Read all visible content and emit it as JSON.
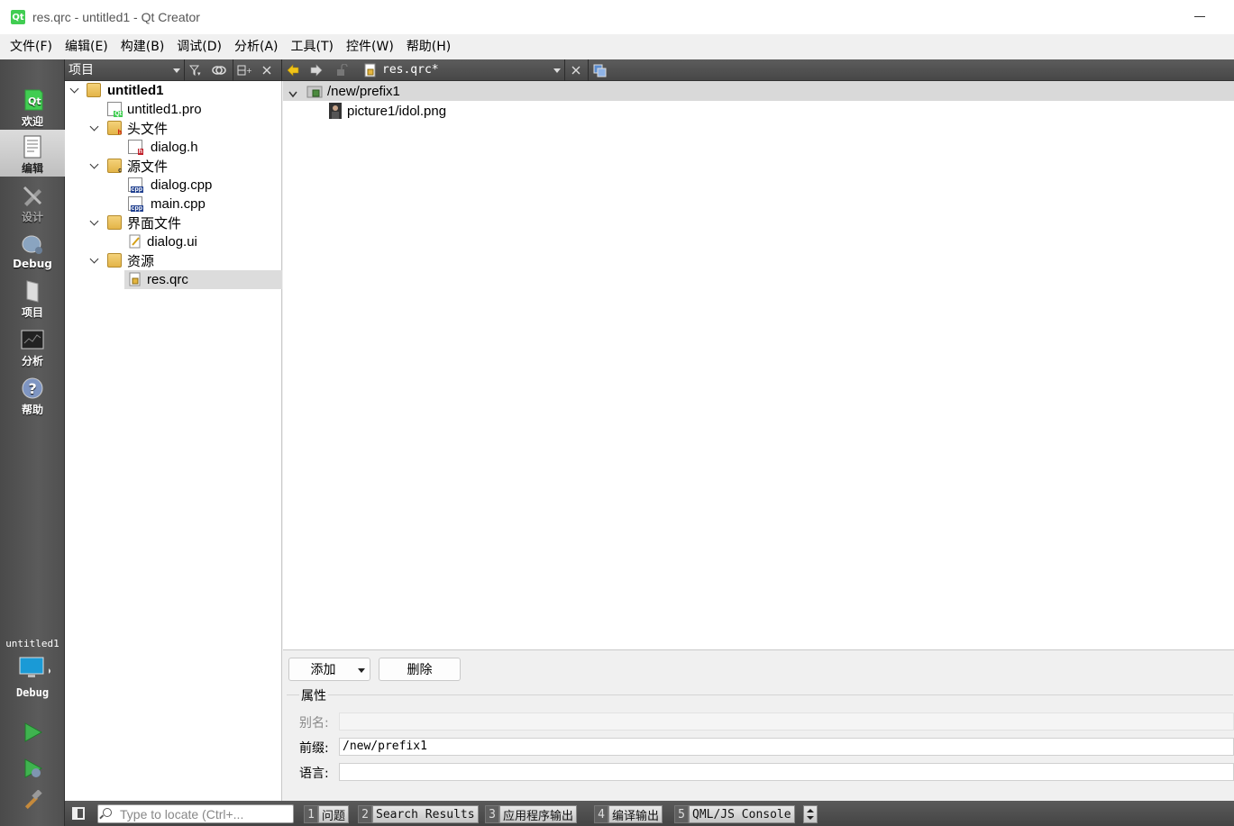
{
  "window": {
    "title": "res.qrc - untitled1 - Qt Creator",
    "logo_text": "Qt"
  },
  "menubar": {
    "items": [
      "文件(F)",
      "编辑(E)",
      "构建(B)",
      "调试(D)",
      "分析(A)",
      "工具(T)",
      "控件(W)",
      "帮助(H)"
    ]
  },
  "modes": {
    "items": [
      {
        "label": "欢迎",
        "icon": "qt-welcome-icon"
      },
      {
        "label": "编辑",
        "icon": "edit-document-icon",
        "active": true
      },
      {
        "label": "设计",
        "icon": "design-pencil-icon",
        "disabled": true
      },
      {
        "label": "Debug",
        "icon": "debug-bug-icon"
      },
      {
        "label": "项目",
        "icon": "project-wrench-icon"
      },
      {
        "label": "分析",
        "icon": "analyze-monitor-icon"
      },
      {
        "label": "帮助",
        "icon": "help-question-icon"
      }
    ],
    "target": {
      "project": "untitled1",
      "build": "Debug"
    }
  },
  "toolstrip": {
    "project_view": "项目",
    "current_file": "res.qrc*"
  },
  "tree": {
    "items": [
      {
        "label": "untitled1",
        "bold": true
      },
      {
        "label": "untitled1.pro"
      },
      {
        "label": "头文件"
      },
      {
        "label": "dialog.h"
      },
      {
        "label": "源文件"
      },
      {
        "label": "dialog.cpp"
      },
      {
        "label": "main.cpp"
      },
      {
        "label": "界面文件"
      },
      {
        "label": "dialog.ui"
      },
      {
        "label": "资源"
      },
      {
        "label": "res.qrc"
      }
    ]
  },
  "editor": {
    "prefix": "/new/prefix1",
    "file": "picture1/idol.png"
  },
  "resource_panel": {
    "add_label": "添加",
    "remove_label": "删除",
    "group_title": "属性",
    "alias_label": "别名:",
    "alias_value": "",
    "prefix_label": "前缀:",
    "prefix_value": "/new/prefix1",
    "lang_label": "语言:",
    "lang_value": ""
  },
  "statusbar": {
    "locator_placeholder": "Type to locate (Ctrl+...",
    "tabs": [
      {
        "num": "1",
        "label": "问题"
      },
      {
        "num": "2",
        "label": "Search Results"
      },
      {
        "num": "3",
        "label": "应用程序输出"
      },
      {
        "num": "4",
        "label": "编译输出"
      },
      {
        "num": "5",
        "label": "QML/JS Console"
      }
    ]
  }
}
